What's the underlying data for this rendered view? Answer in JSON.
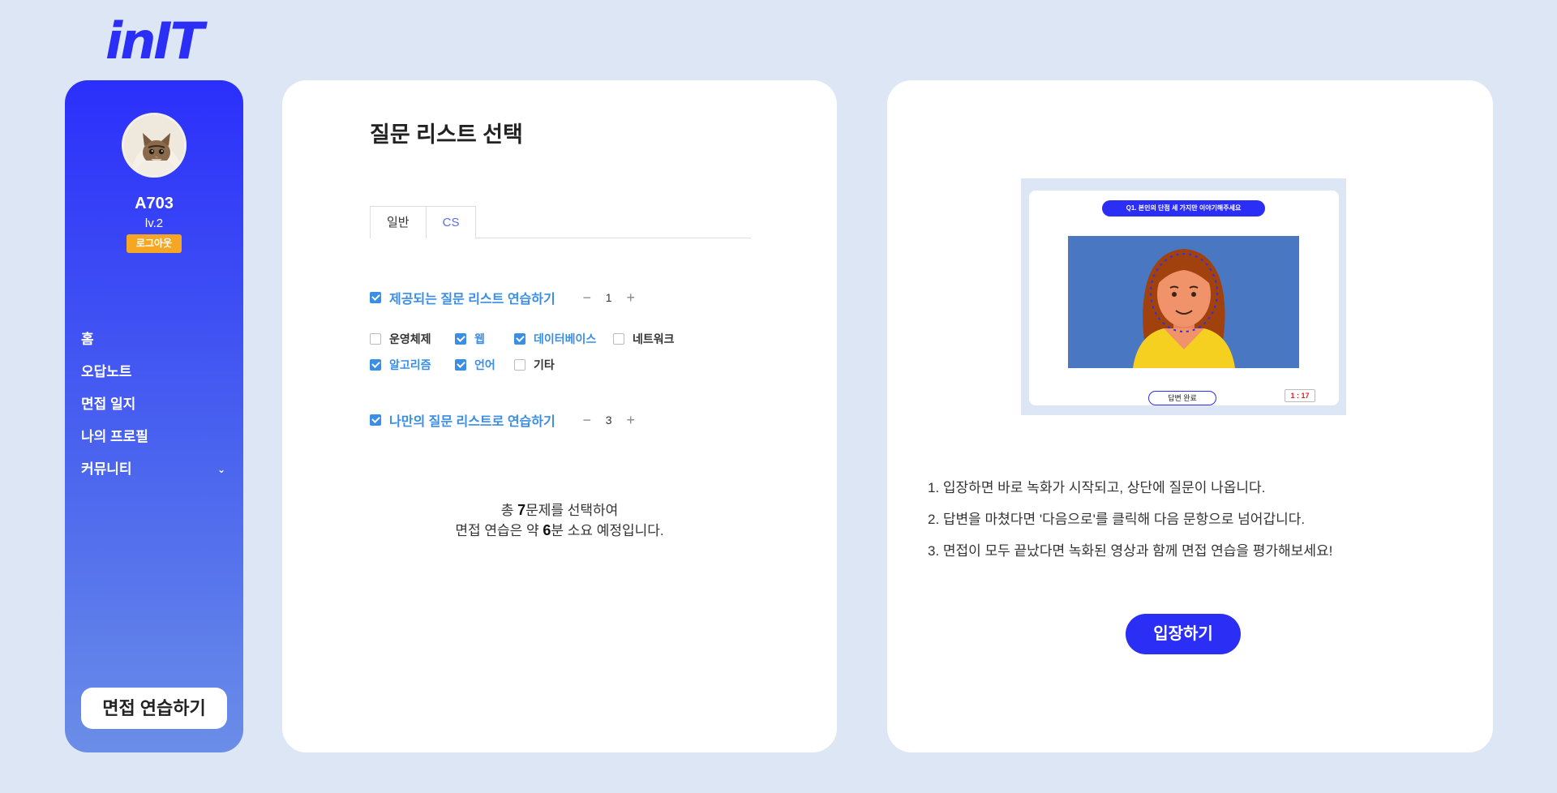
{
  "logo": "inIT",
  "sidebar": {
    "username": "A703",
    "level": "lv.2",
    "logout_label": "로그아웃",
    "nav": [
      {
        "label": "홈"
      },
      {
        "label": "오답노트"
      },
      {
        "label": "면접 일지"
      },
      {
        "label": "나의 프로필"
      },
      {
        "label": "커뮤니티"
      }
    ],
    "practice_button": "면접 연습하기",
    "gradient_top": "#2b2ffb",
    "gradient_bottom": "#6a8ee8"
  },
  "question_select": {
    "title": "질문 리스트 선택",
    "tabs": [
      {
        "label": "일반",
        "active": false
      },
      {
        "label": "CS",
        "active": true
      }
    ],
    "provided": {
      "label": "제공되는 질문 리스트 연습하기",
      "checked": true,
      "count": "1",
      "categories": [
        {
          "label": "운영체제",
          "checked": false
        },
        {
          "label": "웹",
          "checked": true
        },
        {
          "label": "데이터베이스",
          "checked": true
        },
        {
          "label": "네트워크",
          "checked": false
        },
        {
          "label": "알고리즘",
          "checked": true
        },
        {
          "label": "언어",
          "checked": true
        },
        {
          "label": "기타",
          "checked": false
        }
      ]
    },
    "custom": {
      "label": "나만의 질문 리스트로 연습하기",
      "checked": true,
      "count": "3"
    },
    "summary": {
      "line1_prefix": "총 ",
      "total": "7",
      "line1_suffix": "문제를 선택하여",
      "line2_prefix": "면접 연습은 약 ",
      "minutes": "6",
      "line2_suffix": "분 소요 예정입니다."
    }
  },
  "guide": {
    "illustration": {
      "question": "Q1. 본인의 단점 세 가지만 이야기해주세요",
      "done_label": "답변 완료",
      "timer": "1 : 17"
    },
    "steps": [
      "1. 입장하면 바로 녹화가 시작되고, 상단에 질문이 나옵니다.",
      "2. 답변을 마쳤다면 '다음으로'를 클릭해 다음 문항으로 넘어갑니다.",
      "3. 면접이 모두 끝났다면 녹화된 영상과 함께 면접 연습을 평가해보세요!"
    ],
    "enter_button": "입장하기"
  },
  "colors": {
    "accent": "#2b2ff5",
    "check_blue": "#3a8ee6",
    "logout_orange": "#f5a623",
    "background": "#dde6f5"
  }
}
